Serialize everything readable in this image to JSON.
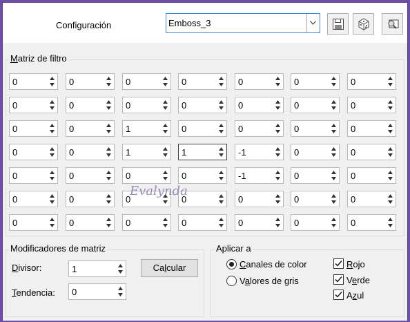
{
  "header": {
    "config_label": "Configuración",
    "preset_value": "Emboss_3",
    "icons": [
      "save-icon",
      "dice-icon",
      "preset-manager-icon"
    ]
  },
  "matrix": {
    "title_prefix": "M",
    "title_rest": "atriz de filtro",
    "rows": [
      [
        "0",
        "0",
        "0",
        "0",
        "0",
        "0",
        "0"
      ],
      [
        "0",
        "0",
        "0",
        "0",
        "0",
        "0",
        "0"
      ],
      [
        "0",
        "0",
        "1",
        "0",
        "0",
        "0",
        "0"
      ],
      [
        "0",
        "0",
        "1",
        "1",
        "-1",
        "0",
        "0"
      ],
      [
        "0",
        "0",
        "0",
        "0",
        "-1",
        "0",
        "0"
      ],
      [
        "0",
        "0",
        "0",
        "0",
        "0",
        "0",
        "0"
      ],
      [
        "0",
        "0",
        "0",
        "0",
        "0",
        "0",
        "0"
      ]
    ]
  },
  "modifiers": {
    "title": "Modificadores de matriz",
    "divisor_prefix": "D",
    "divisor_rest": "ivisor:",
    "divisor_value": "1",
    "bias_prefix": "T",
    "bias_rest": "endencia:",
    "bias_value": "0",
    "calc_prefix": "Ca",
    "calc_u": "l",
    "calc_rest": "cular"
  },
  "apply": {
    "title": "Aplicar a",
    "color_prefix": "C",
    "color_rest": "anales de color",
    "gray_pre": "V",
    "gray_u": "a",
    "gray_rest": "lores de gris",
    "red_pre": "R",
    "red_rest": "ojo",
    "green_pre": "V",
    "green_u": "e",
    "green_rest": "rde",
    "blue_pre": "A",
    "blue_u": "z",
    "blue_rest": "ul",
    "selected": "Canales de color",
    "red_checked": true,
    "green_checked": true,
    "blue_checked": true
  },
  "watermark": "Evalynda",
  "colors": {
    "frame": "#6e4fa8",
    "focus": "#3c7fd1"
  }
}
